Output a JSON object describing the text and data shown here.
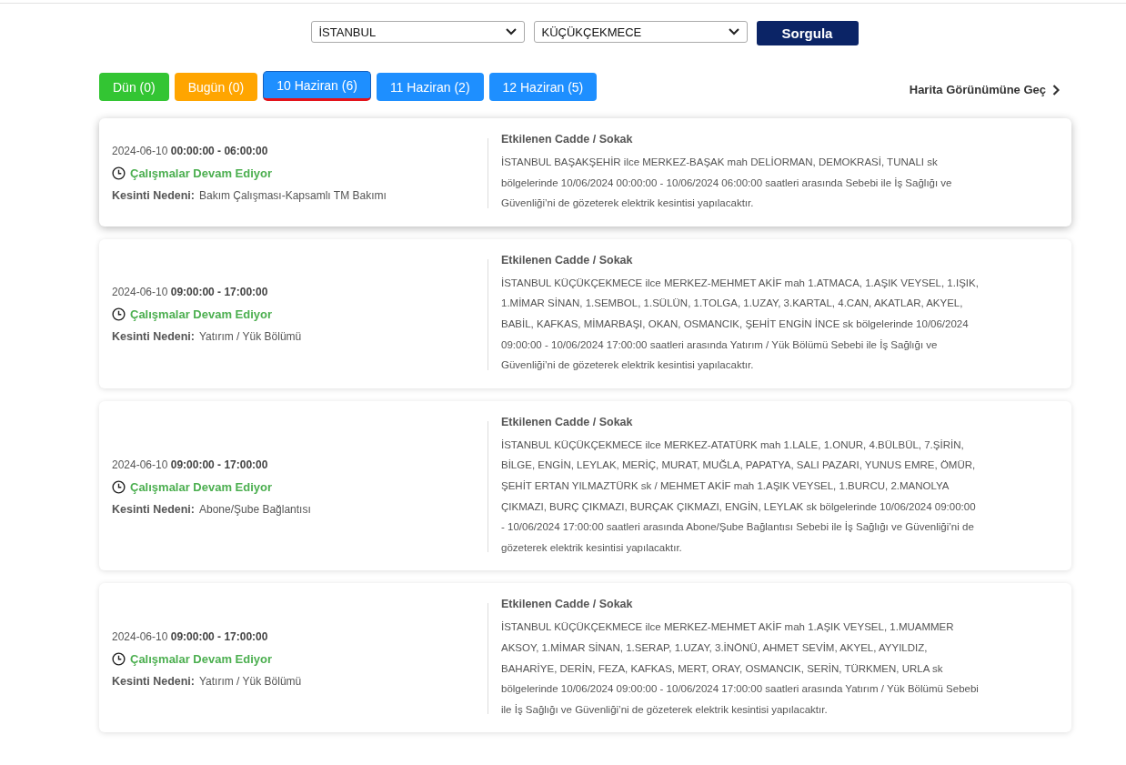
{
  "filters": {
    "city": "İSTANBUL",
    "district": "KÜÇÜKÇEKMECE",
    "submit": "Sorgula"
  },
  "day_tabs": [
    {
      "label": "Dün (0)",
      "selected": false,
      "color": "#33c533"
    },
    {
      "label": "Bugün (0)",
      "selected": false,
      "color": "#ffa500"
    },
    {
      "label": "10 Haziran (6)",
      "selected": true,
      "color": "#1e8fff"
    },
    {
      "label": "11 Haziran (2)",
      "selected": false,
      "color": "#1e8fff"
    },
    {
      "label": "12 Haziran (5)",
      "selected": false,
      "color": "#1e8fff"
    }
  ],
  "map_link": "Harita Görünümüne Geç",
  "outages": [
    {
      "date": "2024-06-10",
      "time": "00:00:00 - 06:00:00",
      "status": "Çalışmalar Devam Ediyor",
      "reason_label": "Kesinti Nedeni:",
      "reason": "Bakım Çalışması-Kapsamlı TM Bakımı",
      "streets_title": "Etkilenen Cadde / Sokak",
      "description": "İSTANBUL BAŞAKŞEHİR ilce MERKEZ-BAŞAK mah DELİORMAN, DEMOKRASİ, TUNALI sk bölgelerinde 10/06/2024 00:00:00 - 10/06/2024 06:00:00 saatleri arasında Sebebi ile İş Sağlığı ve Güvenliği’ni de gözeterek elektrik kesintisi yapılacaktır."
    },
    {
      "date": "2024-06-10",
      "time": "09:00:00 - 17:00:00",
      "status": "Çalışmalar Devam Ediyor",
      "reason_label": "Kesinti Nedeni:",
      "reason": "Yatırım / Yük Bölümü",
      "streets_title": "Etkilenen Cadde / Sokak",
      "description": "İSTANBUL KÜÇÜKÇEKMECE ilce MERKEZ-MEHMET AKİF mah 1.ATMACA, 1.AŞIK VEYSEL, 1.IŞIK, 1.MİMAR SİNAN, 1.SEMBOL, 1.SÜLÜN, 1.TOLGA, 1.UZAY, 3.KARTAL, 4.CAN, AKATLAR, AKYEL, BABİL, KAFKAS, MİMARBAŞI, OKAN, OSMANCIK, ŞEHİT ENGİN İNCE sk bölgelerinde 10/06/2024 09:00:00 - 10/06/2024 17:00:00 saatleri arasında Yatırım / Yük Bölümü Sebebi ile İş Sağlığı ve Güvenliği’ni de gözeterek elektrik kesintisi yapılacaktır."
    },
    {
      "date": "2024-06-10",
      "time": "09:00:00 - 17:00:00",
      "status": "Çalışmalar Devam Ediyor",
      "reason_label": "Kesinti Nedeni:",
      "reason": "Abone/Şube Bağlantısı",
      "streets_title": "Etkilenen Cadde / Sokak",
      "description": "İSTANBUL KÜÇÜKÇEKMECE ilce MERKEZ-ATATÜRK mah 1.LALE, 1.ONUR, 4.BÜLBÜL, 7.ŞİRİN, BİLGE, ENGİN, LEYLAK, MERİÇ, MURAT, MUĞLA, PAPATYA, SALI PAZARI, YUNUS EMRE, ÖMÜR, ŞEHİT ERTAN YILMAZTÜRK sk / MEHMET AKİF mah 1.AŞIK VEYSEL, 1.BURCU, 2.MANOLYA ÇIKMAZI, BURÇ ÇIKMAZI, BURÇAK ÇIKMAZI, ENGİN, LEYLAK sk bölgelerinde 10/06/2024 09:00:00 - 10/06/2024 17:00:00 saatleri arasında Abone/Şube Bağlantısı Sebebi ile İş Sağlığı ve Güvenliği’ni de gözeterek elektrik kesintisi yapılacaktır."
    },
    {
      "date": "2024-06-10",
      "time": "09:00:00 - 17:00:00",
      "status": "Çalışmalar Devam Ediyor",
      "reason_label": "Kesinti Nedeni:",
      "reason": "Yatırım / Yük Bölümü",
      "streets_title": "Etkilenen Cadde / Sokak",
      "description": "İSTANBUL KÜÇÜKÇEKMECE ilce MERKEZ-MEHMET AKİF mah 1.AŞIK VEYSEL, 1.MUAMMER AKSOY, 1.MİMAR SİNAN, 1.SERAP, 1.UZAY, 3.İNÖNÜ, AHMET SEVİM, AKYEL, AYYILDIZ, BAHARİYE, DERİN, FEZA, KAFKAS, MERT, ORAY, OSMANCIK, SERİN, TÜRKMEN, URLA sk bölgelerinde 10/06/2024 09:00:00 - 10/06/2024 17:00:00 saatleri arasında Yatırım / Yük Bölümü Sebebi ile İş Sağlığı ve Güvenliği’ni de gözeterek elektrik kesintisi yapılacaktır."
    }
  ]
}
